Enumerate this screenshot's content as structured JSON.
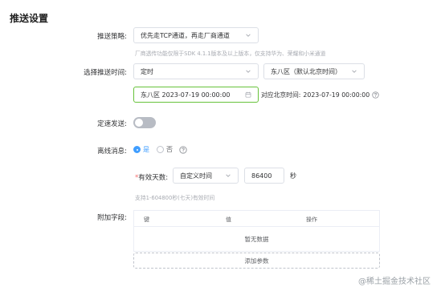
{
  "page": {
    "title": "推送设置"
  },
  "strategy": {
    "label": "推送策略:",
    "value": "优先走TCP通道，再走厂商通道",
    "hint": "厂商透传功能仅限于SDK 4.1.1版本及以上版本，仅支持华为、荣耀和小米通道"
  },
  "push_time": {
    "label": "选择推送时间:",
    "mode_value": "定时",
    "timezone_value": "东八区（默认北京时间）",
    "datetime_value": "东八区 2023-07-19 00:00:00",
    "beijing_label": "对应北京时间:",
    "beijing_value": "2023-07-19 00:00:00"
  },
  "rate": {
    "label": "定速发送:"
  },
  "offline": {
    "label": "离线消息:",
    "yes": "是",
    "no": "否"
  },
  "validity": {
    "required_mark": "*",
    "label": "有效天数:",
    "mode_value": "自定义时间",
    "seconds_value": "86400",
    "unit": "秒",
    "hint": "支持1-604800秒(七天)有效时间"
  },
  "extra": {
    "label": "附加字段:",
    "columns": [
      "键",
      "值",
      "操作"
    ],
    "empty_text": "暂无数据",
    "add_label": "添加参数"
  },
  "watermark": "@稀土掘金技术社区",
  "colors": {
    "accent": "#409eff",
    "focus_border": "#67c23a",
    "required": "#f56c6c"
  }
}
